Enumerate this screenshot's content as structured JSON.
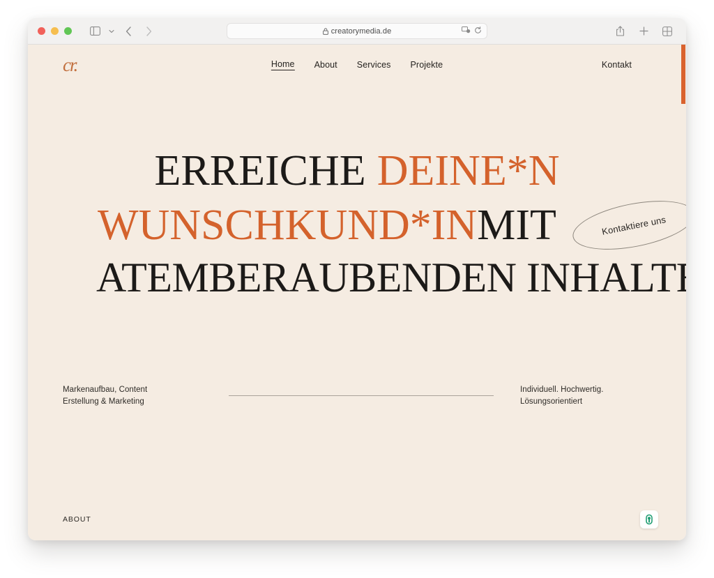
{
  "browser": {
    "traffic_lights": [
      "close",
      "minimize",
      "zoom"
    ],
    "sidebar_button": "sidebar-toggle",
    "back_button": "back",
    "forward_button": "forward",
    "shield_button": "privacy-report",
    "url": "creatorymedia.de",
    "url_lock": "lock-icon",
    "reader_icon": "extensions-icon",
    "reload_icon": "reload-icon",
    "share_icon": "share-icon",
    "new_tab_icon": "plus-icon",
    "tab_overview_icon": "tab-overview-icon"
  },
  "site": {
    "logo": "cr.",
    "nav": [
      {
        "label": "Home",
        "active": true
      },
      {
        "label": "About",
        "active": false
      },
      {
        "label": "Services",
        "active": false
      },
      {
        "label": "Projekte",
        "active": false
      }
    ],
    "contact_link": "Kontakt",
    "headline": {
      "line1_dark": "ERREICHE",
      "line1_accent": "DEINE*N",
      "line2_accent": "WUNSCHKUND*IN",
      "line2_dark": "MIT",
      "line3": "ATEMBERAUBENDEN  INHALTEN"
    },
    "badge_label": "Kontaktiere uns",
    "sub_left": "Markenaufbau, Content\nErstellung & Marketing",
    "sub_left_line1": "Markenaufbau, Content",
    "sub_left_line2": "Erstellung & Marketing",
    "sub_right_line1": "Individuell. Hochwertig.",
    "sub_right_line2": "Lösungsorientiert",
    "footer_label": "ABOUT",
    "cookie_widget": "cookie-consent-icon"
  },
  "colors": {
    "page_bg": "#f5ece2",
    "accent": "#d4622c",
    "ink": "#1c1a18",
    "logo": "#c2703f",
    "scrollbar": "#d9622e",
    "cookie_green": "#1f9d72"
  }
}
